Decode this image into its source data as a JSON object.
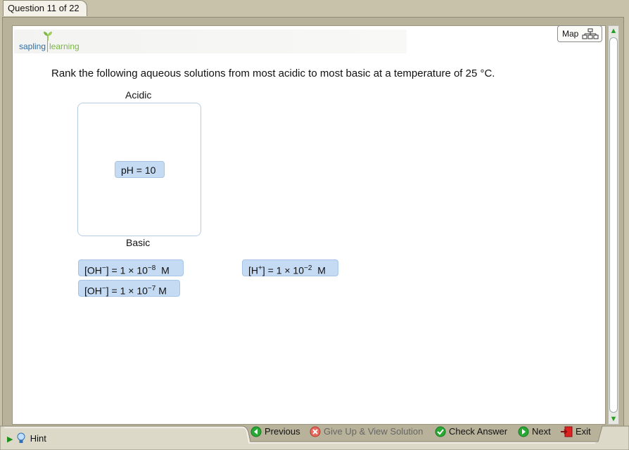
{
  "tab": {
    "label": "Question 11 of 22"
  },
  "logo": {
    "word1": "sapling",
    "word2": "learning"
  },
  "map_button": {
    "label": "Map"
  },
  "question": {
    "text": "Rank the following aqueous solutions from most acidic to most basic at a temperature of 25  °C."
  },
  "ranking": {
    "top_label": "Acidic",
    "bottom_label": "Basic",
    "placed": [
      {
        "text": "pH = 10"
      }
    ]
  },
  "pool": {
    "oh8": {
      "base": "[OH",
      "charge": "−",
      "mid": "] = 1 × 10",
      "exp": "−8",
      "unit": "  M"
    },
    "oh7": {
      "base": "[OH",
      "charge": "−",
      "mid": "] = 1 × 10",
      "exp": "−7",
      "unit": " M"
    },
    "h": {
      "base": "[H",
      "charge": "+",
      "mid": "] = 1 × 10",
      "exp": "−2",
      "unit": "  M"
    }
  },
  "footer": {
    "hint": "Hint",
    "previous": "Previous",
    "give_up": "Give Up & View Solution",
    "check": "Check Answer",
    "next": "Next",
    "exit": "Exit"
  },
  "colors": {
    "chip": "#c5dbf3",
    "accent_green": "#22a022"
  }
}
